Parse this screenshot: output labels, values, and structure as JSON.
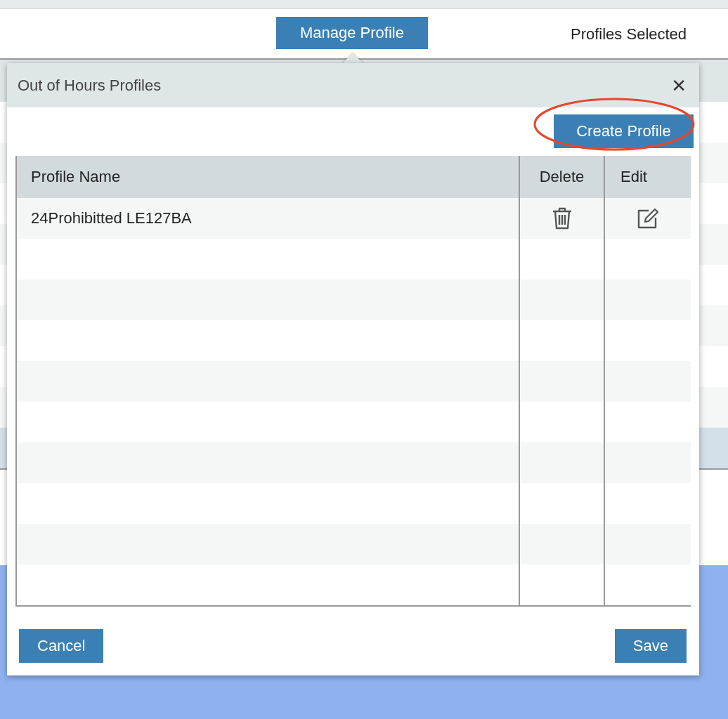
{
  "toolbar": {
    "manage_button": "Manage Profile",
    "selected_label": "Profiles Selected"
  },
  "dialog": {
    "title": "Out of Hours Profiles",
    "close": "✕",
    "create_button": {
      "label": "Create Profile",
      "highlighted": true
    },
    "table": {
      "columns": [
        "Profile Name",
        "Delete",
        "Edit"
      ],
      "rows": [
        {
          "name": "24Prohibitted LE127BA"
        }
      ]
    },
    "buttons": {
      "cancel": "Cancel",
      "save": "Save"
    }
  }
}
